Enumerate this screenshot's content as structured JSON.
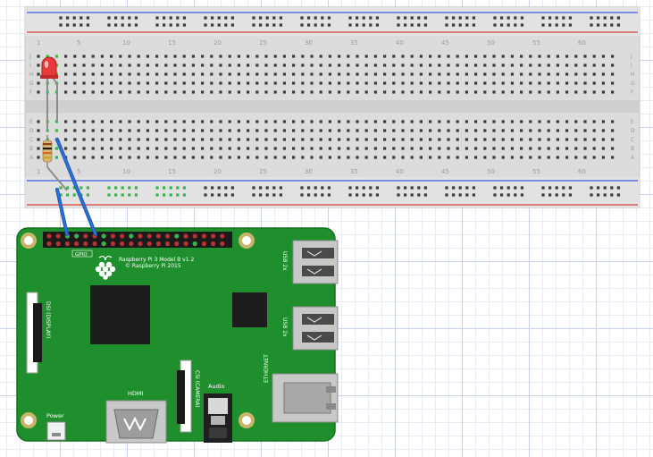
{
  "breadboard": {
    "column_numbers": [
      "1",
      "5",
      "10",
      "15",
      "20",
      "25",
      "30",
      "35",
      "40",
      "45",
      "50",
      "55",
      "60"
    ],
    "row_letters_top": [
      "J",
      "I",
      "H",
      "G",
      "F"
    ],
    "row_letters_bottom": [
      "E",
      "D",
      "C",
      "B",
      "A"
    ]
  },
  "pi": {
    "model_line1": "Raspberry Pi 3 Model B v1.2",
    "model_line2": "© Raspberry Pi 2015",
    "gpio_label": "GPIO",
    "dsi_label": "DSI (DISPLAY)",
    "csi_label": "CSI (CAMERA)",
    "hdmi_label": "HDMI",
    "audio_label": "Audio",
    "power_label": "Power",
    "usb_label_1": "USB 2x",
    "usb_label_2": "USB 2x",
    "ethernet_label": "ETHERNET"
  },
  "colors": {
    "pcb": "#1e8f2c",
    "breadboard": "#dcdcdc",
    "wire": "#2a6fd6",
    "led": "#e83a3a",
    "rail_blue": "#3b5bdb",
    "rail_red": "#d94040"
  },
  "components": {
    "led": "red-led",
    "resistor": "resistor",
    "wires": "blue-jumper-wires"
  }
}
